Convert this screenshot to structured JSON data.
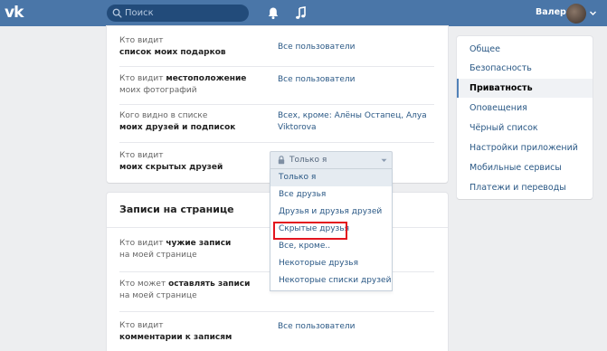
{
  "topbar": {
    "logo_text": "vk",
    "search_placeholder": "Поиск",
    "username": "Валера"
  },
  "privacy_rows_top": [
    {
      "label_plain": "Кто видит",
      "label_bold": "список моих подарков",
      "value": "Все пользователи"
    },
    {
      "label_plain": "Кто видит",
      "label_bold": "местоположение",
      "label_tail": "моих фотографий",
      "value": "Все пользователи"
    },
    {
      "label_plain": "Кого видно в списке",
      "label_bold": "моих друзей и подписок",
      "value_line1": "Всех, кроме: Алёны Остапец, Алуа",
      "value_line2": "Viktorova"
    },
    {
      "label_plain": "Кто видит",
      "label_bold": "моих скрытых друзей"
    }
  ],
  "section": {
    "title": "Записи на странице",
    "rows": [
      {
        "label_plain": "Кто видит",
        "label_bold": "чужие записи",
        "label_tail": "на моей странице"
      },
      {
        "label_plain": "Кто может",
        "label_bold": "оставлять записи",
        "label_tail": "на моей странице"
      },
      {
        "label_plain": "Кто видит",
        "label_bold": "комментарии к записям",
        "value": "Все пользователи"
      }
    ]
  },
  "dropdown": {
    "current": "Только я",
    "options": [
      "Только я",
      "Все друзья",
      "Друзья и друзья друзей",
      "Скрытые друзья",
      "Все, кроме..",
      "Некоторые друзья",
      "Некоторые списки друзей"
    ],
    "hovered_index": 0,
    "highlighted_index": 3
  },
  "menu": {
    "items": [
      "Общее",
      "Безопасность",
      "Приватность",
      "Оповещения",
      "Чёрный список",
      "Настройки приложений",
      "Мобильные сервисы",
      "Платежи и переводы"
    ],
    "active_index": 2
  },
  "colors": {
    "header": "#4a76a8",
    "link": "#2a5885",
    "highlight_border": "#e3141e"
  }
}
